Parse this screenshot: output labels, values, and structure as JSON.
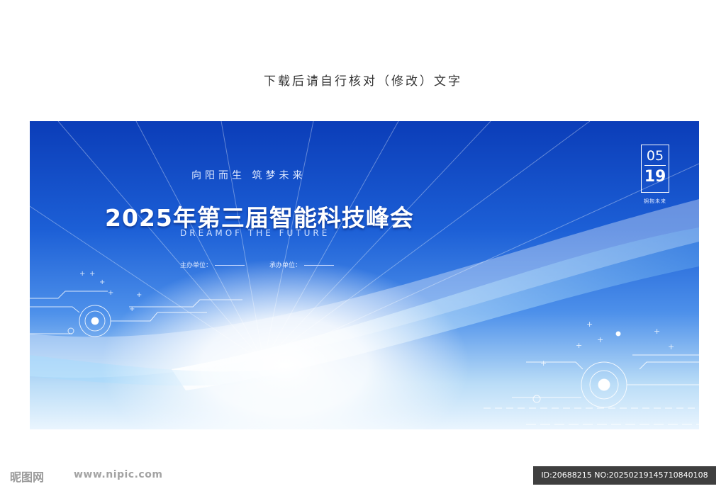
{
  "top_note": "下载后请自行核对（修改）文字",
  "banner": {
    "slogan": "向阳而生  筑梦未来",
    "title": "2025年第三届智能科技峰会",
    "subtitle": "DREAMOF  THE  FUTURE",
    "host_label": "主办单位：",
    "co_label": "承办单位：",
    "date_month": "05",
    "date_day": "19",
    "date_tag": "拥抱未来"
  },
  "footer": {
    "logo": "昵图网",
    "url": "www.nipic.com",
    "id_text": "ID:20688215 NO:20250219145710840108"
  },
  "colors": {
    "banner_top": "#0b3db8",
    "banner_bottom": "#eaf5fe",
    "accent_light": "#ffffff"
  }
}
